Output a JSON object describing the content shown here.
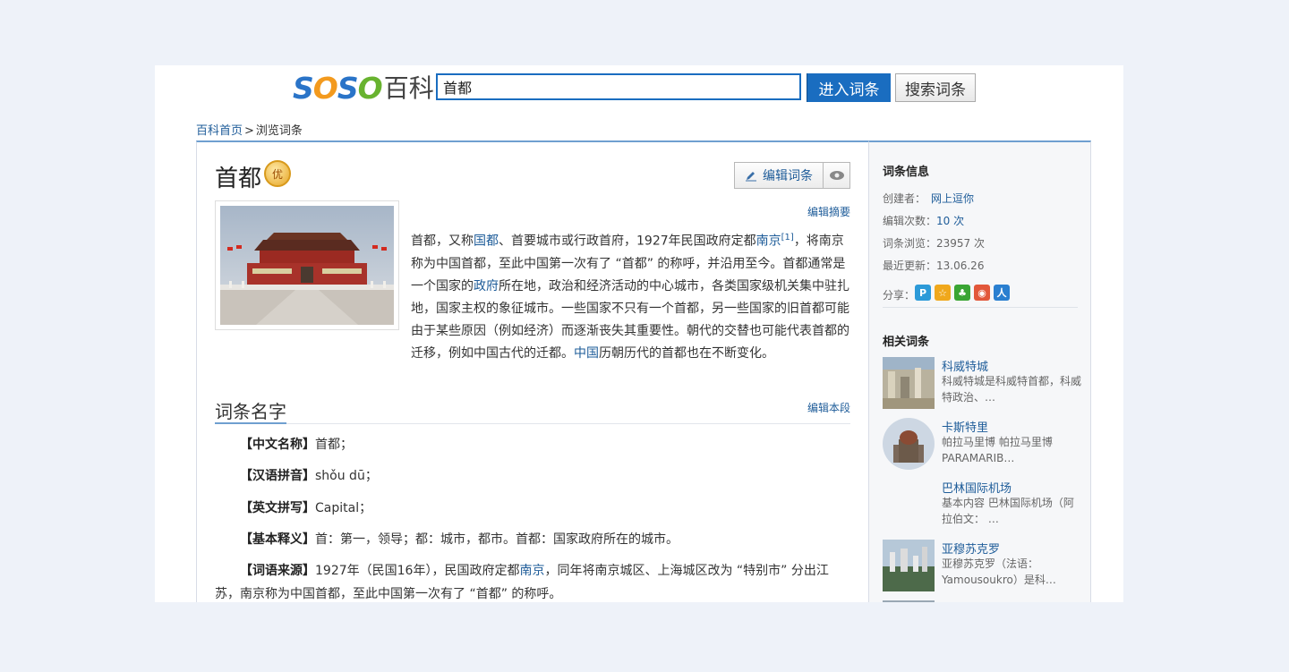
{
  "header": {
    "logo": {
      "s1": "S",
      "o1": "O",
      "s2": "S",
      "o2": "O",
      "baike": "百科"
    },
    "search_value": "首都",
    "enter_button": "进入词条",
    "search_button": "搜索词条"
  },
  "breadcrumb": {
    "home": "百科首页",
    "separator": ">",
    "current": "浏览词条"
  },
  "entry": {
    "title": "首都",
    "badge": "优",
    "edit_entry": "编辑词条",
    "edit_summary": "编辑摘要",
    "summary": {
      "t1": "首都，又称",
      "l1": "国都",
      "t2": "、首要城市或行政首府，1927年民国政府定都",
      "l2": "南京",
      "ref": "[1]",
      "t3": "，将南京称为中国首都，至此中国第一次有了 “首都” 的称呼，并沿用至今。首都通常是一个国家的",
      "l3": "政府",
      "t4": "所在地，政治和经济活动的中心城市，各类国家级机关集中驻扎地，国家主权的象征城市。一些国家不只有一个首都，另一些国家的旧首都可能由于某些原因（例如经济）而逐渐丧失其重要性。朝代的交替也可能代表首都的迁移，例如中国古代的迁都。",
      "l4": "中国",
      "t5": "历朝历代的首都也在不断变化。"
    },
    "section_title": "词条名字",
    "edit_section": "编辑本段",
    "info": [
      {
        "label": "【中文名称】",
        "value": "首都；"
      },
      {
        "label": "【汉语拼音】",
        "value": "shǒu dū；"
      },
      {
        "label": "【英文拼写】",
        "value": "Capital；"
      },
      {
        "label": "【基本释义】",
        "value": "首：第一，领导；都：城市，都市。首都：国家政府所在的城市。"
      }
    ],
    "origin": {
      "label": "【词语来源】",
      "t1": "1927年（民国16年），民国政府定都",
      "link": "南京",
      "t2": "，同年将南京城区、上海城区改为 “特别市” 分出江",
      "line2": "苏，南京称为中国首都，至此中国第一次有了 “首都” 的称呼。"
    }
  },
  "sidebar": {
    "info_title": "词条信息",
    "creator_label": "创建者：",
    "creator": "网上逗你",
    "edits_label": "编辑次数：",
    "edits": "10 次",
    "views_label": "词条浏览：",
    "views": "23957 次",
    "updated_label": "最近更新：",
    "updated": "13.06.26",
    "share_label": "分享：",
    "related_title": "相关词条",
    "related": [
      {
        "title": "科威特城",
        "desc": "科威特城是科威特首都，科威特政治、…"
      },
      {
        "title": "卡斯特里",
        "desc": "帕拉马里博  帕拉马里博 PARAMARIB…"
      },
      {
        "title": "巴林国际机场",
        "desc": "基本内容  巴林国际机场（阿拉伯文：  …"
      },
      {
        "title": "亚穆苏克罗",
        "desc": "亚穆苏克罗（法语：Yamousoukro）是科…"
      }
    ]
  },
  "colors": {
    "accent": "#1a6dc0",
    "link": "#1e5c99",
    "page_bg": "#eef2f9"
  }
}
